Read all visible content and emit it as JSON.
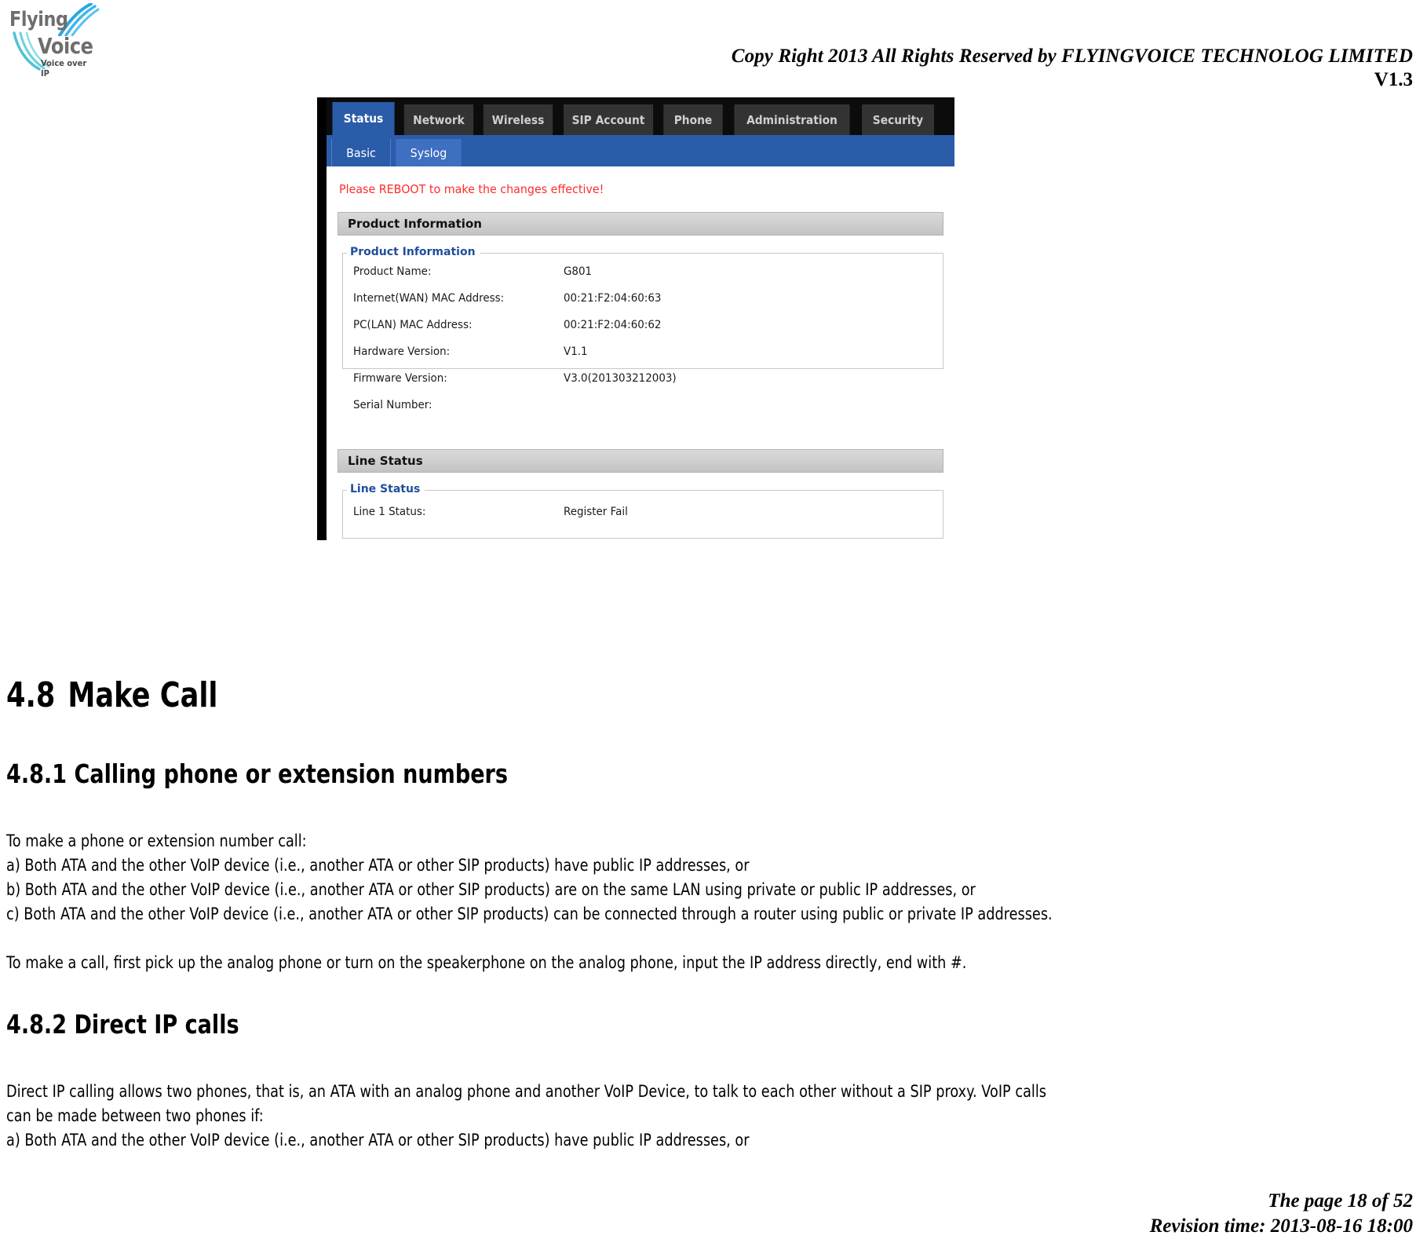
{
  "header": {
    "logo": {
      "line1": "Flying",
      "line2": "Voice",
      "tagline": "Voice over IP"
    },
    "copyright": "Copy Right 2013 All Rights Reserved by FLYINGVOICE TECHNOLOG LIMITED",
    "version": "V1.3"
  },
  "screenshot": {
    "nav_tabs": [
      {
        "label": "Status",
        "active": true
      },
      {
        "label": "Network",
        "active": false
      },
      {
        "label": "Wireless",
        "active": false
      },
      {
        "label": "SIP Account",
        "active": false
      },
      {
        "label": "Phone",
        "active": false
      },
      {
        "label": "Administration",
        "active": false
      },
      {
        "label": "Security",
        "active": false
      }
    ],
    "sub_tabs": [
      {
        "label": "Basic",
        "selected": true
      },
      {
        "label": "Syslog",
        "selected": false
      }
    ],
    "reboot_notice": "Please REBOOT to make the changes effective!",
    "product_panel": {
      "panel_title": "Product Information",
      "legend": "Product Information",
      "rows": [
        {
          "label": "Product Name:",
          "value": "G801"
        },
        {
          "label": "Internet(WAN) MAC Address:",
          "value": "00:21:F2:04:60:63"
        },
        {
          "label": "PC(LAN) MAC Address:",
          "value": "00:21:F2:04:60:62"
        },
        {
          "label": "Hardware Version:",
          "value": "V1.1"
        },
        {
          "label": "Firmware Version:",
          "value": "V3.0(201303212003)"
        },
        {
          "label": "Serial Number:",
          "value": ""
        }
      ]
    },
    "line_panel": {
      "panel_title": "Line Status",
      "legend": "Line Status",
      "rows": [
        {
          "label": "Line 1 Status:",
          "value": "Register Fail"
        }
      ]
    }
  },
  "document": {
    "section_48": {
      "number": "4.8",
      "title": "Make Call"
    },
    "section_481": "4.8.1 Calling phone or extension numbers",
    "para_481_intro": "To make a phone or extension number call:",
    "para_481_a": "a) Both ATA and the other VoIP device (i.e., another ATA or other SIP products) have public IP addresses, or",
    "para_481_b": "b) Both ATA and the other VoIP device (i.e., another ATA or other SIP products) are on the same LAN using private or public IP addresses, or",
    "para_481_c": "c) Both ATA and the other VoIP device (i.e., another ATA or other SIP products) can be connected through a router using public or private IP addresses.",
    "para_481_tail": "To make a call, first pick up the analog phone or turn on the speakerphone on the analog phone, input the IP address directly, end with #.",
    "section_482": "4.8.2 Direct IP calls",
    "para_482_1": "Direct IP calling allows two phones, that is, an ATA with an analog phone and another VoIP Device, to talk to each other without a SIP proxy. VoIP calls",
    "para_482_2": "can be made between two phones if:",
    "para_482_a": "a) Both ATA and the other VoIP device (i.e., another ATA or other SIP products) have public IP addresses, or"
  },
  "footer": {
    "page": "The page 18 of 52",
    "revision": "Revision time: 2013-08-16 18:00"
  }
}
